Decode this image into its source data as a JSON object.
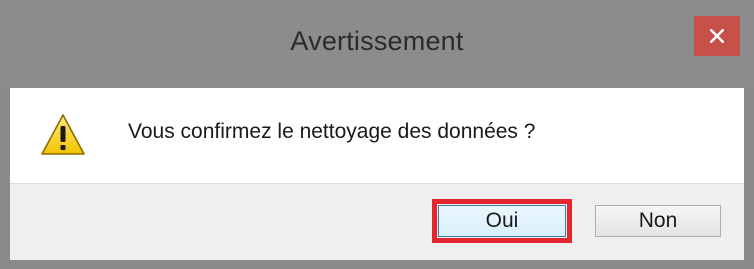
{
  "dialog": {
    "title": "Avertissement",
    "message": "Vous confirmez le nettoyage des données ?",
    "icon": "warning-icon",
    "close_icon": "close-icon",
    "buttons": {
      "yes": "Oui",
      "no": "Non"
    },
    "colors": {
      "close_button": "#c7504a",
      "highlight": "#e5262e",
      "titlebar": "#8c8c8c"
    }
  }
}
